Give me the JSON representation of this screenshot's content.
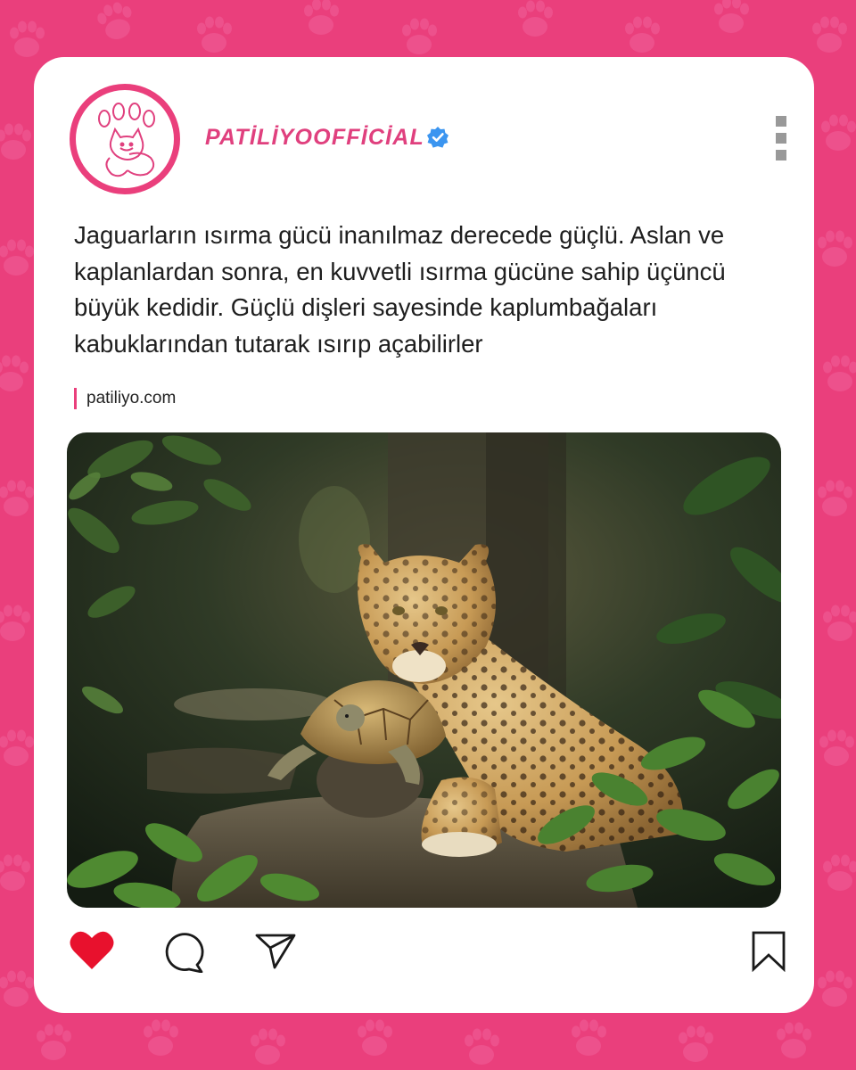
{
  "post": {
    "username": "PATİLİYOOFFİCİAL",
    "verified": true,
    "caption": "Jaguarların ısırma gücü inanılmaz derecede güçlü. Aslan ve kaplanlardan sonra, en kuvvetli ısırma gücüne sahip üçüncü büyük kedidir. Güçlü dişleri sayesinde kaplumbağaları kabuklarından tutarak ısırıp açabilirler",
    "source": "patiliyo.com",
    "liked": true
  },
  "icons": {
    "avatar": "cat-paw-logo-icon",
    "verified": "verified-badge-icon",
    "menu": "more-options-icon",
    "like": "heart-icon",
    "comment": "comment-bubble-icon",
    "share": "paper-plane-icon",
    "save": "bookmark-icon"
  },
  "colors": {
    "background": "#ea3f7c",
    "brand": "#e0407e",
    "verified": "#3b95f0",
    "like": "#e8112d"
  }
}
